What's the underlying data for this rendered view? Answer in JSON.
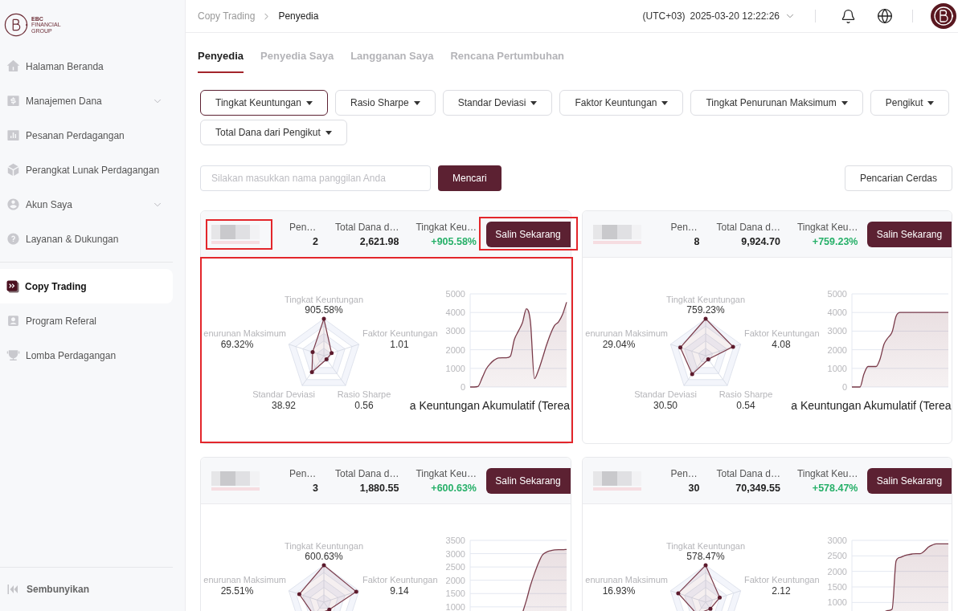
{
  "sidebar": {
    "logo": {
      "lines": [
        "EBC",
        "FINANCIAL",
        "GROUP"
      ]
    },
    "sections": [
      {
        "items": [
          {
            "kind": "link",
            "label": "Halaman Beranda",
            "selected": false
          },
          {
            "kind": "group",
            "label": "Manajemen Dana",
            "selected": false,
            "expanded": false
          },
          {
            "kind": "link",
            "label": "Pesanan Perdagangan",
            "selected": false
          },
          {
            "kind": "link",
            "label": "Perangkat Lunak Perdagangan",
            "selected": false
          },
          {
            "kind": "group",
            "label": "Akun Saya",
            "selected": false,
            "expanded": false
          },
          {
            "kind": "link",
            "label": "Layanan & Dukungan",
            "selected": false
          }
        ]
      },
      {
        "items": [
          {
            "kind": "link",
            "label": "Copy Trading",
            "selected": true
          },
          {
            "kind": "link",
            "label": "Program Referal",
            "selected": false
          },
          {
            "kind": "link",
            "label": "Lomba Perdagangan",
            "selected": false
          }
        ]
      }
    ],
    "collapse_label": "Sembunyikan"
  },
  "header": {
    "breadcrumb": [
      "Copy Trading",
      "Penyedia"
    ],
    "timezone": "(UTC+03)",
    "datetime": "2025-03-20 12:22:26"
  },
  "tabs": [
    {
      "label": "Penyedia",
      "selected": true
    },
    {
      "label": "Penyedia Saya",
      "selected": false
    },
    {
      "label": "Langganan Saya",
      "selected": false
    },
    {
      "label": "Rencana Pertumbuhan",
      "selected": false
    }
  ],
  "filters": [
    {
      "label": "Tingkat Keuntungan",
      "selected": true
    },
    {
      "label": "Rasio Sharpe",
      "selected": false
    },
    {
      "label": "Standar Deviasi",
      "selected": false
    },
    {
      "label": "Faktor Keuntungan",
      "selected": false
    },
    {
      "label": "Tingkat Penurunan Maksimum",
      "selected": false
    },
    {
      "label": "Pengikut",
      "selected": false
    },
    {
      "label": "Total Dana dari Pengikut",
      "selected": false
    }
  ],
  "search": {
    "placeholder": "Silakan masukkan nama panggilan Anda",
    "button": "Mencari",
    "smart_button": "Pencarian Cerdas"
  },
  "providers": [
    {
      "name_highlighted": true,
      "stats": [
        {
          "kind": "plain",
          "label": "Pen…",
          "value": "2"
        },
        {
          "kind": "plain",
          "label": "Total Dana d…",
          "value": "2,621.98"
        },
        {
          "kind": "gain",
          "label": "Tingkat Keu…",
          "value": "+905.58%"
        }
      ],
      "button": {
        "label": "Salin Sekarang",
        "highlighted": true
      },
      "charts_highlighted": true,
      "radar": {
        "indicators": [
          {
            "label": "Tingkat Keuntungan",
            "value": "905.58%"
          },
          {
            "label": "enurunan Maksimum",
            "value": "69.32%"
          },
          {
            "label": "Faktor Keuntungan",
            "value": "1.01"
          },
          {
            "label": "Standar Deviasi",
            "value": "38.92"
          },
          {
            "label": "Rasio Sharpe",
            "value": "0.56"
          }
        ]
      },
      "chart_data": {
        "type": "area",
        "title": "a Keuntungan Akumulatif (Terea",
        "grid": true,
        "ylim": [
          0,
          5000
        ],
        "yticks": [
          0,
          1000,
          2000,
          3000,
          4000,
          5000
        ],
        "values": [
          0,
          0,
          40,
          500,
          970,
          1250,
          1450,
          1560,
          1570,
          1570,
          1650,
          2550,
          3000,
          3450,
          4200,
          3500,
          450,
          900,
          1550,
          2250,
          2850,
          3300,
          3500,
          3900,
          4550
        ]
      }
    },
    {
      "name_highlighted": false,
      "stats": [
        {
          "kind": "plain",
          "label": "Pen…",
          "value": "8"
        },
        {
          "kind": "plain",
          "label": "Total Dana d…",
          "value": "9,924.70"
        },
        {
          "kind": "gain",
          "label": "Tingkat Keu…",
          "value": "+759.23%"
        }
      ],
      "button": {
        "label": "Salin Sekarang",
        "highlighted": false
      },
      "charts_highlighted": false,
      "radar": {
        "indicators": [
          {
            "label": "Tingkat Keuntungan",
            "value": "759.23%"
          },
          {
            "label": "enurunan Maksimum",
            "value": "29.04%"
          },
          {
            "label": "Faktor Keuntungan",
            "value": "4.08"
          },
          {
            "label": "Standar Deviasi",
            "value": "30.50"
          },
          {
            "label": "Rasio Sharpe",
            "value": "0.54"
          }
        ]
      },
      "chart_data": {
        "type": "area",
        "title": "a Keuntungan Akumulatif (Terea",
        "grid": true,
        "ylim": [
          0,
          5000
        ],
        "yticks": [
          0,
          1000,
          2000,
          3000,
          4000,
          5000
        ],
        "values": [
          0,
          0,
          0,
          700,
          1100,
          1100,
          1100,
          1500,
          2300,
          2650,
          2950,
          3800,
          4000,
          4000,
          4000,
          4000,
          4000,
          4000,
          4000,
          4000,
          4000,
          4000,
          4000,
          4000,
          4000
        ]
      }
    },
    {
      "name_highlighted": false,
      "stats": [
        {
          "kind": "plain",
          "label": "Pen…",
          "value": "3"
        },
        {
          "kind": "plain",
          "label": "Total Dana d…",
          "value": "1,880.55"
        },
        {
          "kind": "gain",
          "label": "Tingkat Keu…",
          "value": "+600.63%"
        }
      ],
      "button": {
        "label": "Salin Sekarang",
        "highlighted": false
      },
      "charts_highlighted": false,
      "radar": {
        "indicators": [
          {
            "label": "Tingkat Keuntungan",
            "value": "600.63%"
          },
          {
            "label": "enurunan Maksimum",
            "value": "25.51%"
          },
          {
            "label": "Faktor Keuntungan",
            "value": "9.14"
          }
        ]
      },
      "chart_data": {
        "type": "area",
        "grid": true,
        "ylim": [
          0,
          3500
        ],
        "yticks": [
          1000,
          1500,
          2000,
          2500,
          3000,
          3500
        ],
        "values": [
          null,
          null,
          null,
          null,
          null,
          null,
          null,
          null,
          null,
          null,
          null,
          null,
          null,
          760,
          1250,
          1800,
          2250,
          2650,
          2950,
          3060,
          3110,
          3140,
          3150,
          3150,
          3160
        ]
      }
    },
    {
      "name_highlighted": false,
      "stats": [
        {
          "kind": "plain",
          "label": "Pen…",
          "value": "30"
        },
        {
          "kind": "plain",
          "label": "Total Dana d…",
          "value": "70,349.55"
        },
        {
          "kind": "gain",
          "label": "Tingkat Keu…",
          "value": "+578.47%"
        }
      ],
      "button": {
        "label": "Salin Sekarang",
        "highlighted": false
      },
      "charts_highlighted": false,
      "radar": {
        "indicators": [
          {
            "label": "Tingkat Keuntungan",
            "value": "578.47%"
          },
          {
            "label": "enurunan Maksimum",
            "value": "16.93%"
          },
          {
            "label": "Faktor Keuntungan",
            "value": "2.12"
          }
        ]
      },
      "chart_data": {
        "type": "area",
        "grid": true,
        "ylim": [
          0,
          3000
        ],
        "yticks": [
          1000,
          1500,
          2000,
          2500,
          3000
        ],
        "values": [
          null,
          null,
          null,
          null,
          null,
          null,
          null,
          null,
          700,
          740,
          780,
          2340,
          2450,
          2500,
          2540,
          2560,
          2570,
          2570,
          2650,
          2780,
          2850,
          2890,
          2890,
          2890,
          2890
        ]
      }
    }
  ]
}
